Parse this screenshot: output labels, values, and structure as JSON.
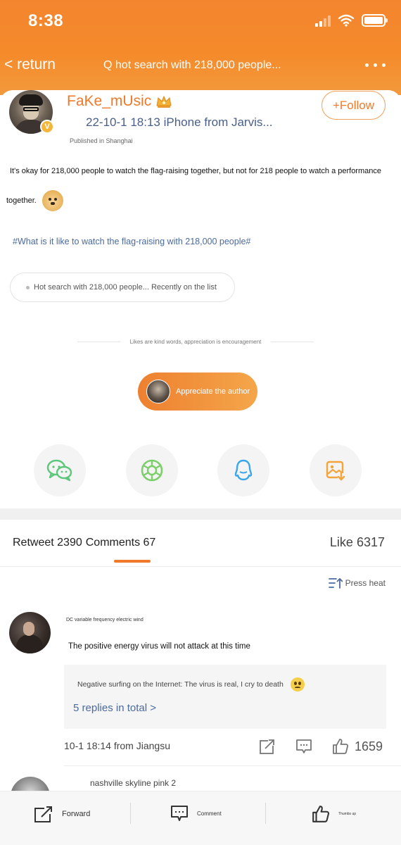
{
  "status_bar": {
    "time": "8:38"
  },
  "nav": {
    "back_label": "< return",
    "title": "Q hot search with 218,000 people..."
  },
  "post": {
    "username": "FaKe_mUsic",
    "meta": "22-10-1 18:13 iPhone from Jarvis...",
    "published": "Published in Shanghai",
    "follow_label": "+Follow",
    "text_line_1": "It's okay for 218,000 people to watch the flag-raising together, but not for 218 people to watch a performance",
    "text_line_2": "together.",
    "hashtag": "#What is it like to watch the flag-raising with 218,000 people#",
    "hot_search": "Hot search with 218,000 people... Recently on the list",
    "likes_hint": "Likes are kind words, appreciation is encouragement",
    "appreciate_label": "Appreciate the author"
  },
  "share": [
    {
      "icon": "wechat-icon",
      "color": "#5cc77a"
    },
    {
      "icon": "moments-icon",
      "color": "#7ccf6a"
    },
    {
      "icon": "qq-icon",
      "color": "#3aa7e8"
    },
    {
      "icon": "save-image-icon",
      "color": "#f3a43a"
    }
  ],
  "stats": {
    "retweet": "Retweet 2390",
    "comments": "Comments 67",
    "like": "Like 6317",
    "sort_label": "Press heat"
  },
  "comment": {
    "author": "DC variable frequency electric wind",
    "text": "The positive energy virus will not attack at this time",
    "reply": "Negative surfing on the Internet: The virus is real, I cry to death",
    "replies_total": "5 replies in total >",
    "time_location": "10-1 18:14 from Jiangsu",
    "likes": "1659"
  },
  "comment_2": {
    "author": "nashville skyline pink 2"
  },
  "bottom_bar": {
    "forward": "Forward",
    "comment": "Comment",
    "thumbs_up": "Thumbs up"
  },
  "colors": {
    "brand_orange": "#f07a2a",
    "link_blue": "#4b6a9e"
  }
}
